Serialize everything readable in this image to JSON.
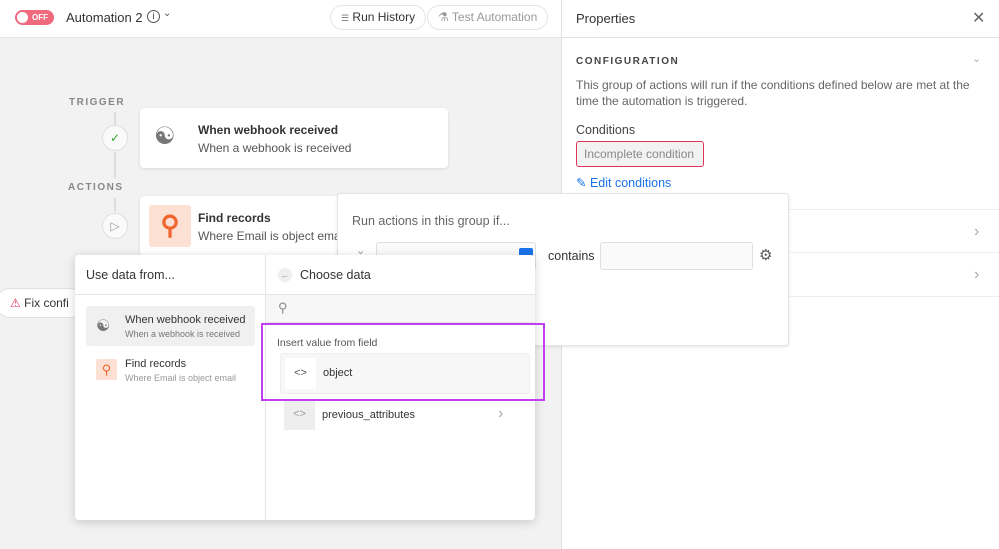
{
  "topbar": {
    "toggle": "OFF",
    "title": "Automation 2",
    "run_history": "Run History",
    "test_automation": "Test Automation"
  },
  "canvas": {
    "trigger_label": "TRIGGER",
    "actions_label": "ACTIONS",
    "trigger": {
      "title": "When webhook received",
      "subtitle": "When a webhook is received"
    },
    "action": {
      "title": "Find records",
      "subtitle": "Where Email is object ema"
    },
    "fix": "Fix confi"
  },
  "condition_popup": {
    "heading": "Run actions in this group if...",
    "operator": "contains"
  },
  "picker": {
    "left_title": "Use data from...",
    "right_title": "Choose data",
    "sources": [
      {
        "title": "When webhook received",
        "subtitle": "When a webhook is received"
      },
      {
        "title": "Find records",
        "subtitle": "Where Email is object email"
      }
    ],
    "section": "Insert value from field",
    "fields": [
      "object",
      "previous_attributes"
    ]
  },
  "properties": {
    "title": "Properties",
    "section": "CONFIGURATION",
    "description": "This group of actions will run if the conditions defined below are met at the time the automation is triggered.",
    "conditions_label": "Conditions",
    "condition": "Incomplete condition",
    "edit": "Edit conditions"
  },
  "colors": {
    "accent": "#1a73e8",
    "error": "#e0335a",
    "highlight": "#c040f0",
    "action_icon": "#f0652f"
  }
}
